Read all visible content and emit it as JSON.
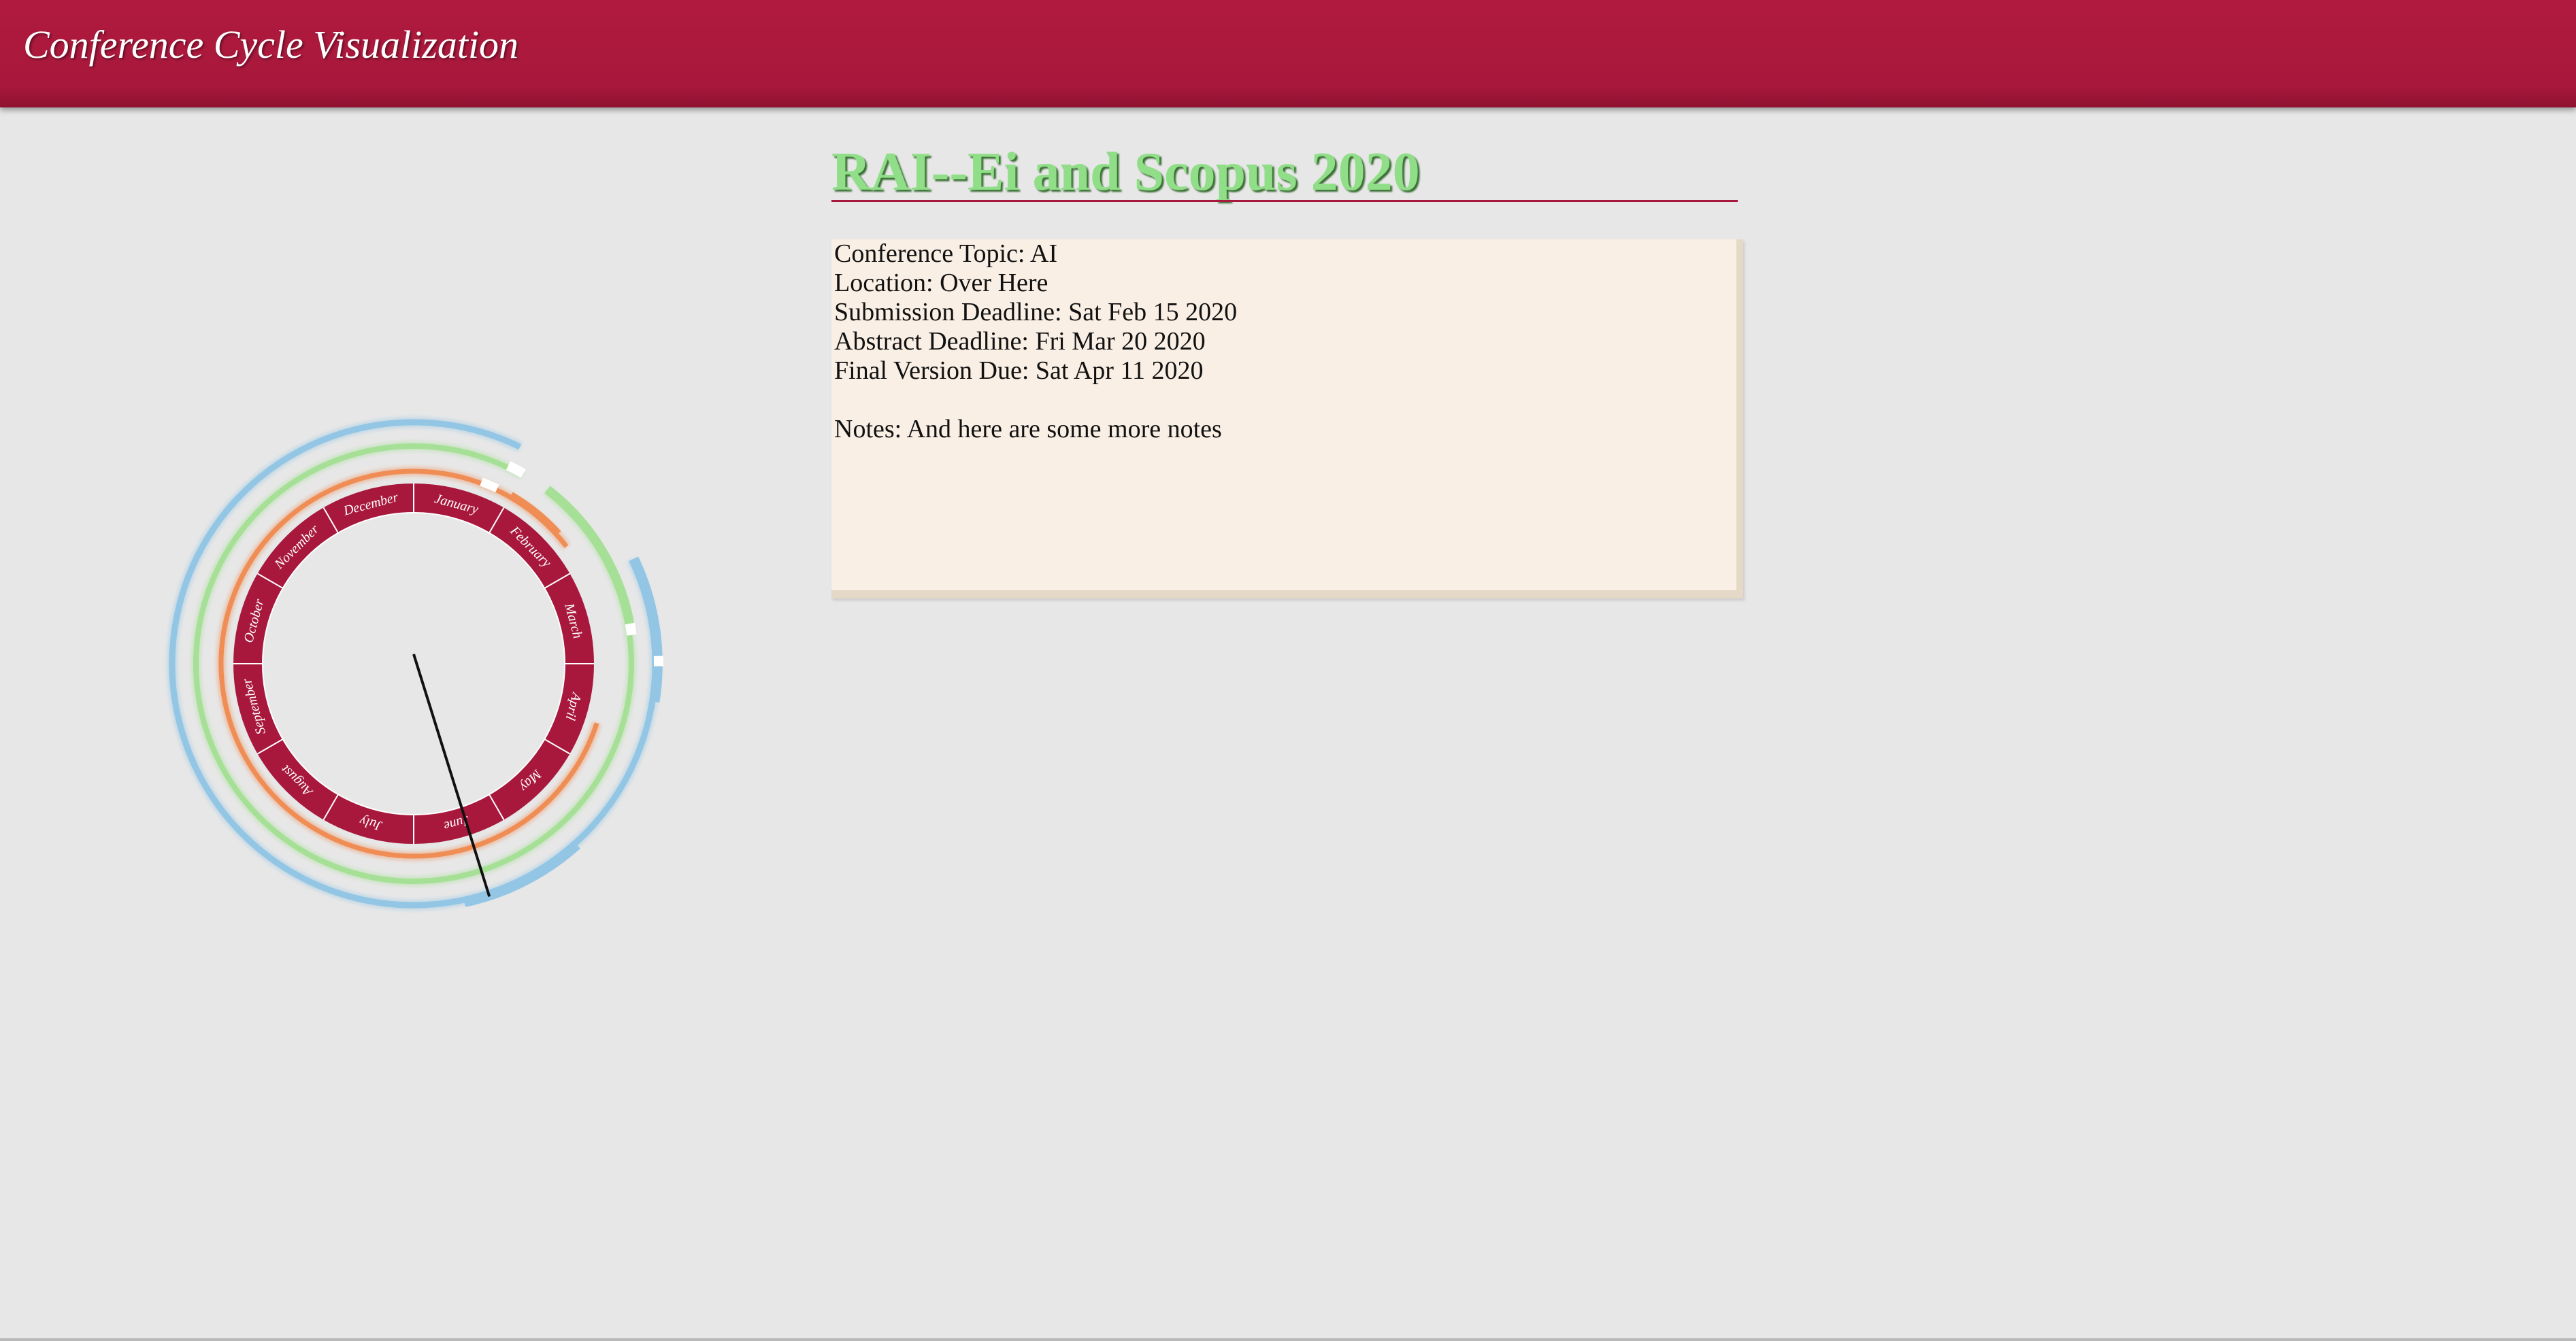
{
  "header": {
    "title": "Conference Cycle Visualization",
    "color": "#a8183c"
  },
  "conference": {
    "title": "RAI--Ei and Scopus 2020",
    "title_color": "#90df88",
    "topic_line": "Conference Topic: AI",
    "location_line": "Location: Over Here",
    "submission_line": "Submission Deadline: Sat Feb 15 2020",
    "abstract_line": "Abstract Deadline: Fri Mar 20 2020",
    "final_line": "Final Version Due: Sat Apr 11 2020",
    "notes_line": "Notes: And here are some more notes"
  },
  "wheel": {
    "months": [
      "January",
      "February",
      "March",
      "April",
      "May",
      "June",
      "July",
      "August",
      "September",
      "October",
      "November",
      "December"
    ],
    "month_ring_color": "#a8183c",
    "hand_month_position": 5.4,
    "rings": [
      {
        "id": "blue",
        "color": "#93c6e4",
        "gap": [
          0.87,
          2.15
        ],
        "accents": [
          [
            2.15,
            3.3
          ],
          [
            4.6,
            5.6
          ]
        ]
      },
      {
        "id": "green",
        "color": "#a6e096",
        "gap": [
          1.0,
          1.25
        ],
        "accents": [
          [
            1.25,
            2.7
          ]
        ],
        "white": [
          [
            0.85,
            1.0
          ]
        ],
        "ticks": [
          2.65
        ]
      },
      {
        "id": "orange",
        "color": "#ef8d55",
        "gap": [
          1.75,
          3.6
        ],
        "accents": [
          [
            1.0,
            1.6
          ]
        ],
        "white": [
          [
            0.68,
            0.85
          ]
        ]
      }
    ]
  }
}
